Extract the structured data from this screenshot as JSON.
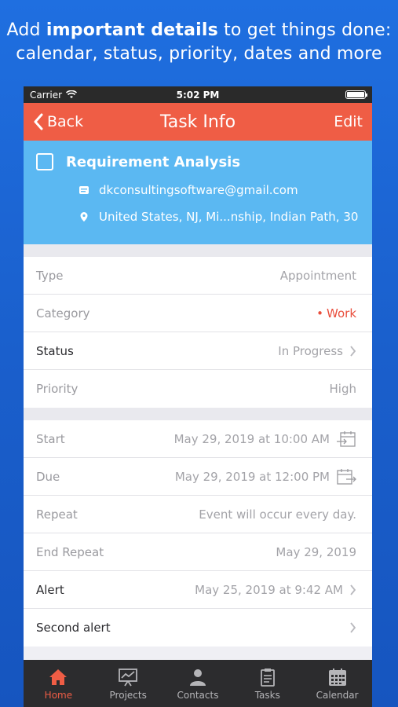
{
  "headline": {
    "line1_pre": "Add ",
    "line1_bold": "important details",
    "line1_post": " to get things done:",
    "line2": "calendar, status, priority, dates and more"
  },
  "statusbar": {
    "carrier": "Carrier",
    "time": "5:02 PM"
  },
  "navbar": {
    "back_label": "Back",
    "title": "Task Info",
    "edit_label": "Edit"
  },
  "task": {
    "title": "Requirement Analysis",
    "email": "dkconsultingsoftware@gmail.com",
    "address": "United States, NJ, Mi...nship, Indian Path, 30"
  },
  "details": [
    {
      "label": "Type",
      "value": "Appointment"
    },
    {
      "label": "Category",
      "value": "Work",
      "bullet": "•"
    },
    {
      "label": "Status",
      "value": "In Progress"
    },
    {
      "label": "Priority",
      "value": "High"
    }
  ],
  "dates": [
    {
      "label": "Start",
      "value": "May 29, 2019 at 10:00 AM"
    },
    {
      "label": "Due",
      "value": "May 29, 2019 at 12:00 PM"
    },
    {
      "label": "Repeat",
      "value": "Event will occur every day."
    },
    {
      "label": "End Repeat",
      "value": "May 29, 2019"
    },
    {
      "label": "Alert",
      "value": "May 25, 2019 at 9:42 AM"
    },
    {
      "label": "Second alert",
      "value": ""
    }
  ],
  "tabs": [
    {
      "label": "Home",
      "icon": "home-icon",
      "active": true
    },
    {
      "label": "Projects",
      "icon": "projects-icon"
    },
    {
      "label": "Contacts",
      "icon": "contacts-icon"
    },
    {
      "label": "Tasks",
      "icon": "tasks-icon"
    },
    {
      "label": "Calendar",
      "icon": "calendar-icon"
    }
  ],
  "colors": {
    "accent": "#ef5d45",
    "header_blue": "#5bb8f2",
    "background_blue": "#1f6fe0",
    "work_red": "#e94e3c"
  }
}
